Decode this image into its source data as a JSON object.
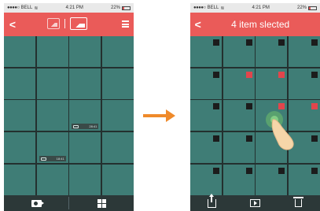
{
  "status": {
    "carrier": "BELL",
    "time": "4:21 PM",
    "battery": "22%"
  },
  "left_screen": {
    "tabs": [
      "photos-tab-icon",
      "gallery-tab-icon"
    ],
    "thumbnails": [
      {
        "duration": "",
        "selected": false
      },
      {
        "duration": "",
        "selected": false
      },
      {
        "duration": "",
        "selected": false
      },
      {
        "duration": "",
        "selected": false
      },
      {
        "duration": "",
        "selected": false
      },
      {
        "duration": "",
        "selected": false
      },
      {
        "duration": "",
        "selected": false
      },
      {
        "duration": "",
        "selected": false
      },
      {
        "duration": "",
        "selected": false
      },
      {
        "duration": "",
        "selected": false
      },
      {
        "duration": "28:41",
        "selected": false
      },
      {
        "duration": "",
        "selected": false
      },
      {
        "duration": "",
        "selected": false
      },
      {
        "duration": "18:41",
        "selected": false
      },
      {
        "duration": "",
        "selected": false
      },
      {
        "duration": "",
        "selected": false
      },
      {
        "duration": "",
        "selected": false
      },
      {
        "duration": "",
        "selected": false
      },
      {
        "duration": "",
        "selected": false
      },
      {
        "duration": "",
        "selected": false
      }
    ]
  },
  "right_screen": {
    "title": "4 item slected",
    "thumbnails": [
      {
        "selected": false
      },
      {
        "selected": false
      },
      {
        "selected": false
      },
      {
        "selected": false
      },
      {
        "selected": false
      },
      {
        "selected": true
      },
      {
        "selected": true
      },
      {
        "selected": false
      },
      {
        "selected": false
      },
      {
        "selected": false
      },
      {
        "selected": true
      },
      {
        "selected": true
      },
      {
        "selected": false
      },
      {
        "selected": false
      },
      {
        "selected": false
      },
      {
        "selected": false
      },
      {
        "selected": false
      },
      {
        "selected": false
      },
      {
        "selected": false
      },
      {
        "selected": false
      }
    ]
  },
  "colors": {
    "navbar": "#ea5b59",
    "cell": "#3f7d76",
    "selected_mark": "#e2454c",
    "arrow": "#ef8a2a"
  }
}
